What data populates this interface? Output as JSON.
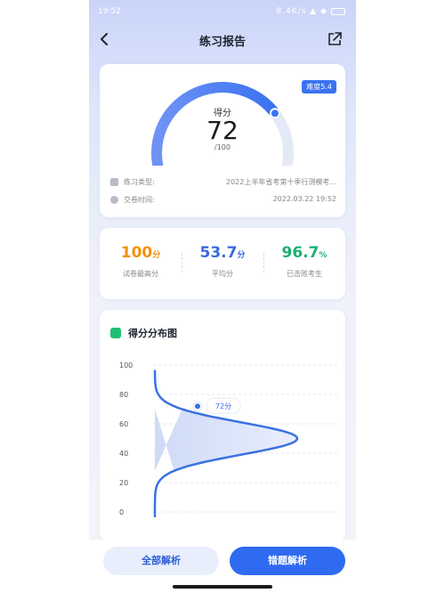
{
  "status_bar": {
    "time": "19:52",
    "right_text": "8.4K/s ▲ ◆"
  },
  "header": {
    "title": "练习报告"
  },
  "report": {
    "difficulty_badge": "难度5.4",
    "score_label": "得分",
    "score": 72,
    "score_max": "/100",
    "info": [
      {
        "label": "练习类型:",
        "value": "2022上半年省考第十季行测模考...",
        "icon": "doc-icon"
      },
      {
        "label": "交卷时间:",
        "value": "2022.03.22 19:52",
        "icon": "clock-icon"
      }
    ]
  },
  "stats": [
    {
      "value": "100",
      "unit": "分",
      "caption": "试卷最高分",
      "color": "#f0920c"
    },
    {
      "value": "53.7",
      "unit": "分",
      "caption": "平均分",
      "color": "#3a6ae0"
    },
    {
      "value": "96.7",
      "unit": "%",
      "caption": "已击败考生",
      "color": "#1bb070"
    }
  ],
  "distribution": {
    "title": "得分分布图",
    "marker_label": "72分"
  },
  "chart_data": {
    "type": "area",
    "title": "得分分布图",
    "y_ticks": [
      "100",
      "80",
      "60",
      "40",
      "20",
      "0"
    ],
    "ylim": [
      0,
      100
    ],
    "orientation": "horizontal-density",
    "distribution": {
      "peak_score": 50,
      "spread": 11
    },
    "marker": {
      "score": 72,
      "label": "72分"
    },
    "grid": true,
    "color": "#3a72e0"
  },
  "actions": {
    "all_analysis": "全部解析",
    "wrong_analysis": "错题解析"
  }
}
